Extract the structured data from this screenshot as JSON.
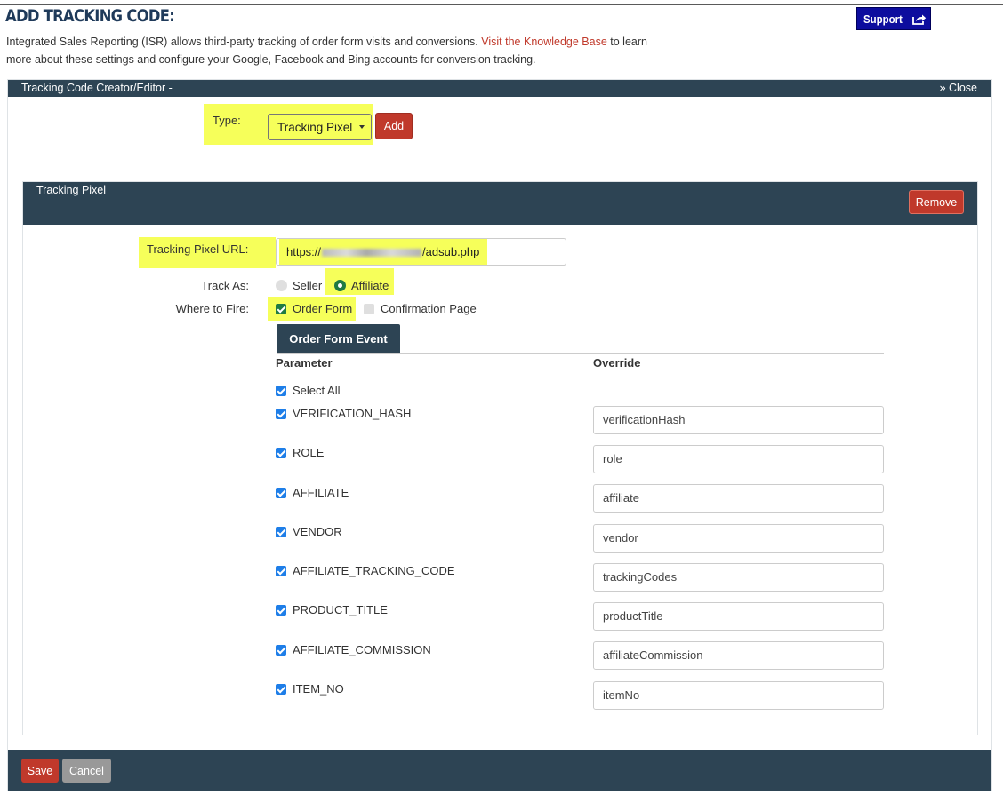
{
  "page": {
    "title": "ADD TRACKING CODE:",
    "support_label": "Support",
    "intro_before_link": "Integrated Sales Reporting (ISR) allows third-party tracking of order form visits and conversions. ",
    "intro_link": "Visit the Knowledge Base",
    "intro_after_link": " to learn more about these settings and configure your Google, Facebook and Bing accounts for conversion tracking."
  },
  "editor": {
    "title": "Tracking Code Creator/Editor -",
    "close_label": "» Close",
    "type_label": "Type:",
    "type_selected": "Tracking Pixel",
    "add_label": "Add"
  },
  "pixel": {
    "title": "Tracking Pixel",
    "remove_label": "Remove",
    "url_label": "Tracking Pixel URL:",
    "url_prefix": "https://",
    "url_suffix": "/adsub.php",
    "track_as_label": "Track As:",
    "track_as_options": [
      {
        "label": "Seller",
        "selected": false
      },
      {
        "label": "Affiliate",
        "selected": true
      }
    ],
    "fire_label": "Where to Fire:",
    "fire_options": [
      {
        "label": "Order Form",
        "checked": true
      },
      {
        "label": "Confirmation Page",
        "checked": false
      }
    ],
    "event_tab": "Order Form Event",
    "col_parameter": "Parameter",
    "col_override": "Override",
    "select_all": "Select All",
    "params": [
      {
        "name": "VERIFICATION_HASH",
        "override": "verificationHash",
        "checked": true
      },
      {
        "name": "ROLE",
        "override": "role",
        "checked": true
      },
      {
        "name": "AFFILIATE",
        "override": "affiliate",
        "checked": true
      },
      {
        "name": "VENDOR",
        "override": "vendor",
        "checked": true
      },
      {
        "name": "AFFILIATE_TRACKING_CODE",
        "override": "trackingCodes",
        "checked": true
      },
      {
        "name": "PRODUCT_TITLE",
        "override": "productTitle",
        "checked": true
      },
      {
        "name": "AFFILIATE_COMMISSION",
        "override": "affiliateCommission",
        "checked": true
      },
      {
        "name": "ITEM_NO",
        "override": "itemNo",
        "checked": true
      }
    ]
  },
  "footer": {
    "save_label": "Save",
    "cancel_label": "Cancel"
  },
  "colors": {
    "header_bg": "#2d4454",
    "accent_red": "#c0392b",
    "highlight": "#f6ff5a",
    "support_blue": "#0d0d9e",
    "checkbox_blue": "#1e7ee8",
    "checkbox_green": "#1f7a43"
  }
}
